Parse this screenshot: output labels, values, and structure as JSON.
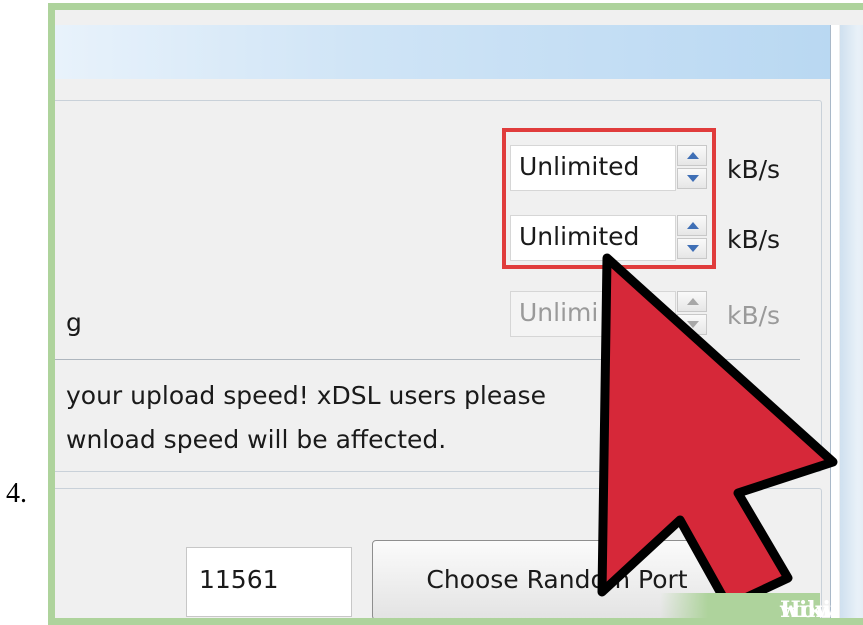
{
  "step_number": "4.",
  "rate_limits": {
    "rows": [
      {
        "value": "Unlimited",
        "unit": "kB/s",
        "enabled": true
      },
      {
        "value": "Unlimited",
        "unit": "kB/s",
        "enabled": true
      },
      {
        "label": "g",
        "value": "Unlimi",
        "unit": "kB/s",
        "enabled": false
      }
    ],
    "warning_line1": "your upload speed! xDSL users please",
    "warning_line2": "wnload speed will be affected."
  },
  "connection": {
    "port_value": "11561",
    "random_port_button": "Choose Random Port"
  },
  "watermark": {
    "part1": "wiki",
    "part2": "How"
  },
  "colors": {
    "frame": "#aed39c",
    "highlight": "#e03c3c",
    "cursor_fill": "#d62839",
    "cursor_stroke": "#000000"
  }
}
